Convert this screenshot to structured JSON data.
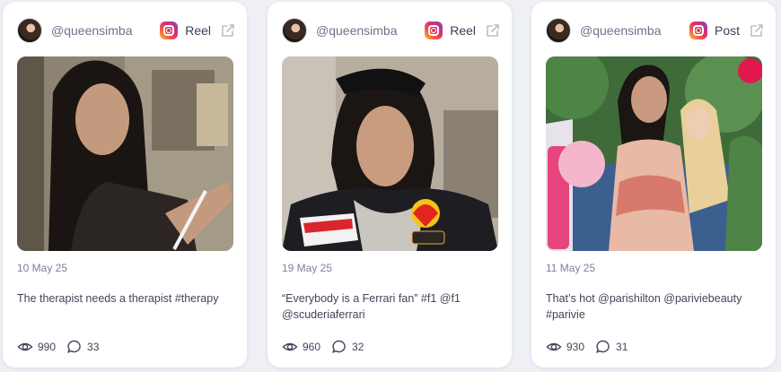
{
  "cards": [
    {
      "handle": "@queensimba",
      "type": "Reel",
      "date": "10 May 25",
      "caption": "The therapist needs a therapist #therapy",
      "views": "990",
      "comments": "33"
    },
    {
      "handle": "@queensimba",
      "type": "Reel",
      "date": "19 May 25",
      "caption": "“Everybody is a Ferrari fan” #f1 @f1 @scuderiaferrari",
      "views": "960",
      "comments": "32"
    },
    {
      "handle": "@queensimba",
      "type": "Post",
      "date": "11 May 25",
      "caption": "That’s hot @parishilton @pariviebeauty #parivie",
      "views": "930",
      "comments": "31"
    }
  ],
  "icons": {
    "platform": "instagram-icon",
    "open": "external-link-icon",
    "views": "eye-icon",
    "comments": "comment-icon"
  }
}
